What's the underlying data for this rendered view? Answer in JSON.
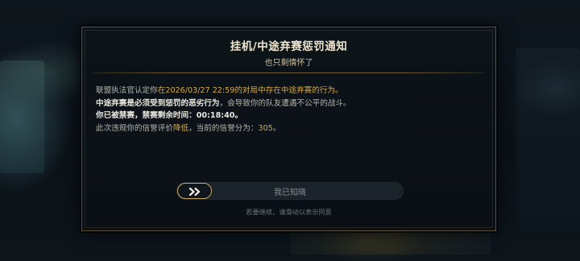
{
  "dialog": {
    "title": "挂机/中途弃赛惩罚通知",
    "subtitle": "也只剩情怀了",
    "lines": {
      "l1": {
        "prefix": "联盟执法官认定你",
        "highlight": "在2026/03/27 22:59的对局中存在中途弃赛的行为。"
      },
      "l2": {
        "bold": "中途弃赛是必须受到惩罚的恶劣行为",
        "rest": "，会导致你的队友遭遇不公平的战斗。"
      },
      "l3": {
        "bold": "你已被禁赛，禁赛剩余时间：00:18:40。"
      },
      "l4": {
        "prefix": "此次违规你的信誉评价",
        "rating": "降低",
        "middle": "，当前的信誉分为：",
        "score": "305",
        "suffix": "。"
      }
    },
    "slider": {
      "label": "我已知晓",
      "handle_icon": "double-chevron-right-icon"
    },
    "hint": "若要继续，请滑动以表示同意"
  },
  "colors": {
    "accent_gold": "#d2a94e",
    "border_gold": "#5e5238",
    "title": "#efe7d2",
    "body_text": "#b7b6ad"
  }
}
